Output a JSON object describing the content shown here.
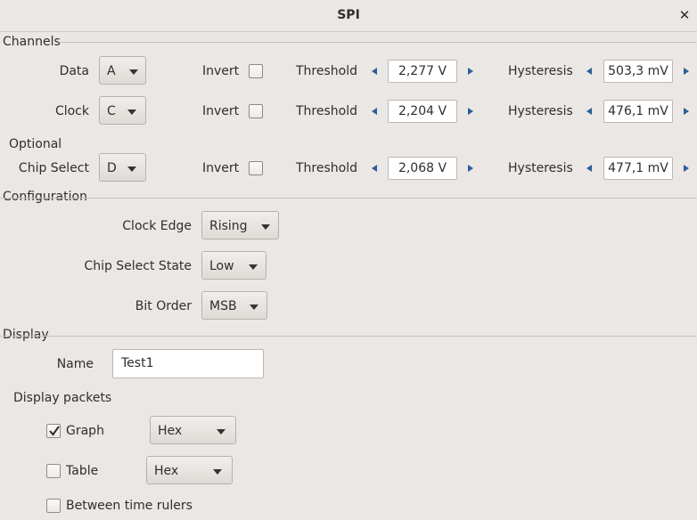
{
  "window": {
    "title": "SPI",
    "close_glyph": "✕"
  },
  "channels": {
    "section_label": "Channels",
    "optional_label": "Optional",
    "invert_label": "Invert",
    "threshold_label": "Threshold",
    "hysteresis_label": "Hysteresis",
    "rows": [
      {
        "label": "Data",
        "channel": "A",
        "invert": false,
        "threshold": "2,277 V",
        "hysteresis": "503,3 mV"
      },
      {
        "label": "Clock",
        "channel": "C",
        "invert": false,
        "threshold": "2,204 V",
        "hysteresis": "476,1 mV"
      },
      {
        "label": "Chip Select",
        "channel": "D",
        "invert": false,
        "threshold": "2,068 V",
        "hysteresis": "477,1 mV"
      }
    ]
  },
  "configuration": {
    "section_label": "Configuration",
    "clock_edge": {
      "label": "Clock Edge",
      "value": "Rising"
    },
    "chip_select_state": {
      "label": "Chip Select State",
      "value": "Low"
    },
    "bit_order": {
      "label": "Bit Order",
      "value": "MSB"
    }
  },
  "display": {
    "section_label": "Display",
    "name_label": "Name",
    "name_value": "Test1",
    "packets_label": "Display packets",
    "graph": {
      "label": "Graph",
      "checked": true,
      "format": "Hex"
    },
    "table": {
      "label": "Table",
      "checked": false,
      "format": "Hex"
    },
    "between_rulers": {
      "label": "Between time rulers",
      "checked": false
    }
  },
  "icons": {
    "close": "close-icon",
    "decrement": "arrow-left-icon",
    "increment": "arrow-right-icon",
    "dropdown": "chevron-down-icon",
    "check": "checkmark-icon"
  }
}
